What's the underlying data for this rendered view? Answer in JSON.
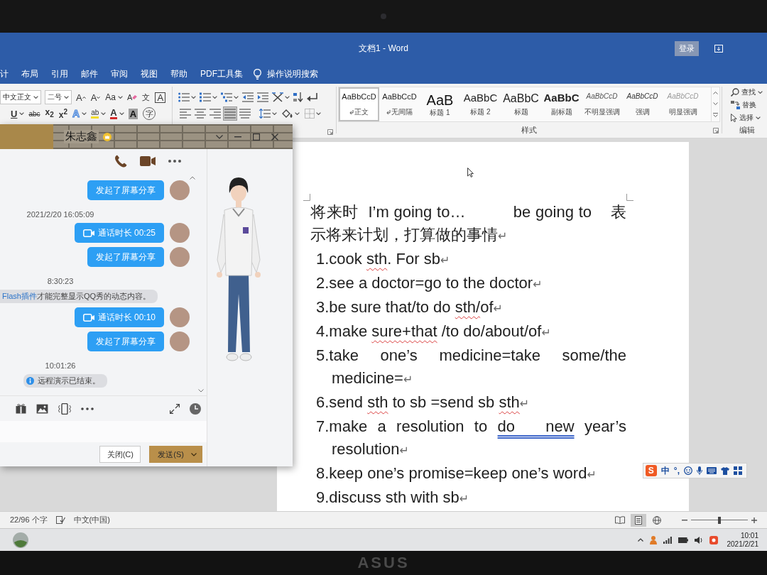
{
  "bezel": {
    "brand": "ASUS"
  },
  "title_bar": {
    "title": "文档1 - Word",
    "sign_in": "登录"
  },
  "tabs": [
    {
      "label": "计",
      "selected": false
    },
    {
      "label": "布局",
      "selected": false
    },
    {
      "label": "引用",
      "selected": false
    },
    {
      "label": "邮件",
      "selected": false
    },
    {
      "label": "审阅",
      "selected": false
    },
    {
      "label": "视图",
      "selected": false
    },
    {
      "label": "帮助",
      "selected": false
    },
    {
      "label": "PDF工具集",
      "selected": false
    }
  ],
  "tell_me": {
    "placeholder": "操作说明搜索"
  },
  "ribbon": {
    "font": {
      "font_name": "中文正文",
      "font_size": "二号",
      "row_1": [
        {
          "kind": "grow",
          "label": "A",
          "dropdown": false
        },
        {
          "kind": "shrink",
          "label": "A",
          "dropdown": false
        },
        {
          "kind": "case",
          "label": "Aa",
          "dropdown": true
        },
        {
          "kind": "clear",
          "label": "A",
          "dropdown": false
        },
        {
          "kind": "pinyin",
          "label": "文",
          "dropdown": false
        },
        {
          "kind": "border",
          "label": "A",
          "dropdown": false
        }
      ],
      "row_2": [
        {
          "kind": "underline",
          "label": "U",
          "dropdown": true
        },
        {
          "kind": "strike",
          "label": "abc",
          "dropdown": false
        },
        {
          "kind": "subscript",
          "label": "x$_{2}$",
          "dropdown": false
        },
        {
          "kind": "superscript",
          "label": "x$^{2}$",
          "dropdown": false
        },
        {
          "kind": "effects",
          "label": "A",
          "dropdown": true
        },
        {
          "kind": "highlight",
          "label": "ab",
          "dropdown": true
        },
        {
          "kind": "color",
          "label": "A",
          "dropdown": true
        },
        {
          "kind": "shading",
          "label": "A",
          "dropdown": false
        },
        {
          "kind": "enclose",
          "label": "字",
          "dropdown": false
        }
      ]
    },
    "paragraph": {
      "row_1": [
        {
          "kind": "bullets",
          "dropdown": true
        },
        {
          "kind": "numbering",
          "dropdown": true
        },
        {
          "kind": "multilevel",
          "dropdown": true
        },
        {
          "kind": "outdent",
          "dropdown": false
        },
        {
          "kind": "indent",
          "dropdown": false
        },
        {
          "kind": "layout",
          "dropdown": true
        },
        {
          "kind": "sort",
          "dropdown": false
        },
        {
          "kind": "marks",
          "dropdown": false
        }
      ],
      "alignment": [
        {
          "kind": "left",
          "selected": false
        },
        {
          "kind": "center",
          "selected": false
        },
        {
          "kind": "right",
          "selected": false
        },
        {
          "kind": "justify",
          "selected": true
        },
        {
          "kind": "distributed",
          "selected": false
        }
      ],
      "row_2": [
        {
          "kind": "spacing",
          "dropdown": true
        },
        {
          "kind": "fill",
          "dropdown": true
        },
        {
          "kind": "borders",
          "dropdown": true
        }
      ]
    },
    "styles": {
      "label": "样式",
      "items": [
        {
          "preview": "AaBbCcD",
          "label": "正文",
          "kind": "body",
          "paragraph_mark": true,
          "selected": true
        },
        {
          "preview": "AaBbCcD",
          "label": "无间隔",
          "kind": "body",
          "paragraph_mark": true,
          "selected": false
        },
        {
          "preview": "AaB",
          "label": "标题 1",
          "kind": "heading",
          "paragraph_mark": false,
          "selected": false
        },
        {
          "preview": "AaBbC",
          "label": "标题 2",
          "kind": "subheading",
          "paragraph_mark": false,
          "selected": false
        },
        {
          "preview": "AaBbC",
          "label": "标题",
          "kind": "title",
          "paragraph_mark": false,
          "selected": false
        },
        {
          "preview": "AaBbC",
          "label": "副标题",
          "kind": "subtitle",
          "paragraph_mark": false,
          "selected": false
        },
        {
          "preview": "AaBbCcD",
          "label": "不明显强调",
          "kind": "subtle",
          "paragraph_mark": false,
          "selected": false
        },
        {
          "preview": "AaBbCcD",
          "label": "强调",
          "kind": "emphasis",
          "paragraph_mark": false,
          "selected": false
        },
        {
          "preview": "AaBbCcD",
          "label": "明显强调",
          "kind": "intense",
          "paragraph_mark": false,
          "selected": false
        }
      ]
    },
    "editing": {
      "label": "编辑",
      "items": [
        {
          "kind": "find",
          "label": "查找",
          "dropdown": true
        },
        {
          "kind": "replace",
          "label": "替换",
          "dropdown": false
        },
        {
          "kind": "select",
          "label": "选择",
          "dropdown": true
        }
      ]
    }
  },
  "document": {
    "paragraphs": [
      {
        "kind": "intro",
        "parts": [
          {
            "text": "将来时  I’m going to…          be going to    表示将来计划，打算做的事情",
            "kind": "plain"
          },
          {
            "text": "↵",
            "kind": "mark"
          }
        ]
      },
      {
        "kind": "item",
        "parts": [
          {
            "text": "1.cook ",
            "kind": "plain"
          },
          {
            "text": "sth",
            "kind": "spelling"
          },
          {
            "text": ". For sb",
            "kind": "plain"
          },
          {
            "text": "↵",
            "kind": "mark"
          }
        ]
      },
      {
        "kind": "item",
        "parts": [
          {
            "text": "2.see a doctor=go to the doctor",
            "kind": "plain"
          },
          {
            "text": "↵",
            "kind": "mark"
          }
        ]
      },
      {
        "kind": "item",
        "parts": [
          {
            "text": "3.be sure that/to do ",
            "kind": "plain"
          },
          {
            "text": "sth/",
            "kind": "spelling"
          },
          {
            "text": "of",
            "kind": "plain"
          },
          {
            "text": "↵",
            "kind": "mark"
          }
        ]
      },
      {
        "kind": "item",
        "parts": [
          {
            "text": "4.make ",
            "kind": "plain"
          },
          {
            "text": "sure+that",
            "kind": "spelling"
          },
          {
            "text": " /to do/about/of",
            "kind": "plain"
          },
          {
            "text": "↵",
            "kind": "mark"
          }
        ]
      },
      {
        "kind": "item",
        "parts": [
          {
            "text": "5.take one’s medicine=take some/the medicine=",
            "kind": "plain"
          },
          {
            "text": "↵",
            "kind": "mark"
          }
        ]
      },
      {
        "kind": "item",
        "parts": [
          {
            "text": "6.send ",
            "kind": "plain"
          },
          {
            "text": "sth",
            "kind": "spelling"
          },
          {
            "text": " to sb =send sb ",
            "kind": "plain"
          },
          {
            "text": "sth",
            "kind": "spelling"
          },
          {
            "text": "↵",
            "kind": "mark"
          }
        ]
      },
      {
        "kind": "item",
        "parts": [
          {
            "text": "7.make a resolution to ",
            "kind": "plain"
          },
          {
            "text": "do   new",
            "kind": "grammar"
          },
          {
            "text": " year’s resolution",
            "kind": "plain"
          },
          {
            "text": "↵",
            "kind": "mark"
          }
        ]
      },
      {
        "kind": "item",
        "parts": [
          {
            "text": "8.keep one’s promise=keep one’s word",
            "kind": "plain"
          },
          {
            "text": "↵",
            "kind": "mark"
          }
        ]
      },
      {
        "kind": "item",
        "parts": [
          {
            "text": "9.discuss sth with sb",
            "kind": "plain"
          },
          {
            "text": "↵",
            "kind": "mark"
          }
        ]
      }
    ]
  },
  "chat": {
    "contact": "朱志鑫",
    "messages": [
      {
        "kind": "bubble",
        "text": "发起了屏幕分享"
      },
      {
        "kind": "time",
        "text": "2021/2/20 16:05:09"
      },
      {
        "kind": "call",
        "text": "通话时长 00:25"
      },
      {
        "kind": "bubble",
        "text": "发起了屏幕分享"
      },
      {
        "kind": "time",
        "text": "8:30:23"
      },
      {
        "kind": "notice",
        "link": "Flash插件",
        "text": "才能完整显示QQ秀的动态内容。"
      },
      {
        "kind": "call",
        "text": "通话时长 00:10"
      },
      {
        "kind": "bubble",
        "text": "发起了屏幕分享"
      },
      {
        "kind": "time",
        "text": "10:01:26"
      },
      {
        "kind": "info",
        "text": "远程演示已结束。"
      }
    ],
    "buttons": {
      "close": "关闭(C)",
      "send": "发送(S)"
    }
  },
  "ime_bar": {
    "logo": "S",
    "mode": "中",
    "punctuation": "°,"
  },
  "status_bar": {
    "word_count": "22/96 个字",
    "language": "中文(中国)",
    "views": [
      {
        "kind": "read",
        "selected": false
      },
      {
        "kind": "print",
        "selected": true
      },
      {
        "kind": "web",
        "selected": false
      }
    ],
    "zoom": {
      "level": 0.5
    }
  },
  "taskbar": {
    "time": "10:01",
    "date": "2021/2/21"
  }
}
